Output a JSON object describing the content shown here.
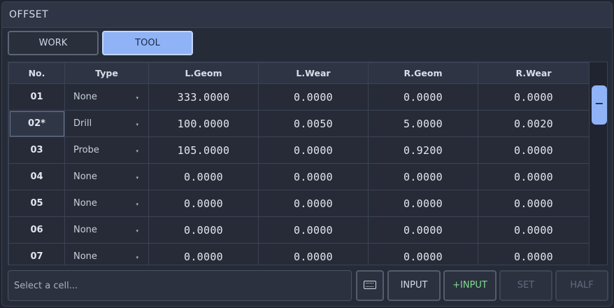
{
  "title": "OFFSET",
  "tabs": [
    {
      "label": "WORK",
      "active": false
    },
    {
      "label": "TOOL",
      "active": true
    }
  ],
  "table": {
    "headers": [
      "No.",
      "Type",
      "L.Geom",
      "L.Wear",
      "R.Geom",
      "R.Wear"
    ],
    "rows": [
      {
        "no": "01",
        "type": "None",
        "lgeom": "333.0000",
        "lwear": "0.0000",
        "rgeom": "0.0000",
        "rwear": "0.0000"
      },
      {
        "no": "02*",
        "type": "Drill",
        "lgeom": "100.0000",
        "lwear": "0.0050",
        "rgeom": "5.0000",
        "rwear": "0.0020"
      },
      {
        "no": "03",
        "type": "Probe",
        "lgeom": "105.0000",
        "lwear": "0.0000",
        "rgeom": "0.9200",
        "rwear": "0.0000"
      },
      {
        "no": "04",
        "type": "None",
        "lgeom": "0.0000",
        "lwear": "0.0000",
        "rgeom": "0.0000",
        "rwear": "0.0000"
      },
      {
        "no": "05",
        "type": "None",
        "lgeom": "0.0000",
        "lwear": "0.0000",
        "rgeom": "0.0000",
        "rwear": "0.0000"
      },
      {
        "no": "06",
        "type": "None",
        "lgeom": "0.0000",
        "lwear": "0.0000",
        "rgeom": "0.0000",
        "rwear": "0.0000"
      },
      {
        "no": "07",
        "type": "None",
        "lgeom": "0.0000",
        "lwear": "0.0000",
        "rgeom": "0.0000",
        "rwear": "0.0000"
      }
    ]
  },
  "scroll": {
    "thumb_label": "−"
  },
  "bottom": {
    "input_placeholder": "Select a cell...",
    "keyboard_icon": "keyboard-icon",
    "input_label": "INPUT",
    "plus_input_label": "+INPUT",
    "set_label": "SET",
    "half_label": "HALF"
  },
  "colors": {
    "accent": "#8fb3f6",
    "plus_input": "#7fdc8d",
    "disabled": "#626a7b"
  }
}
